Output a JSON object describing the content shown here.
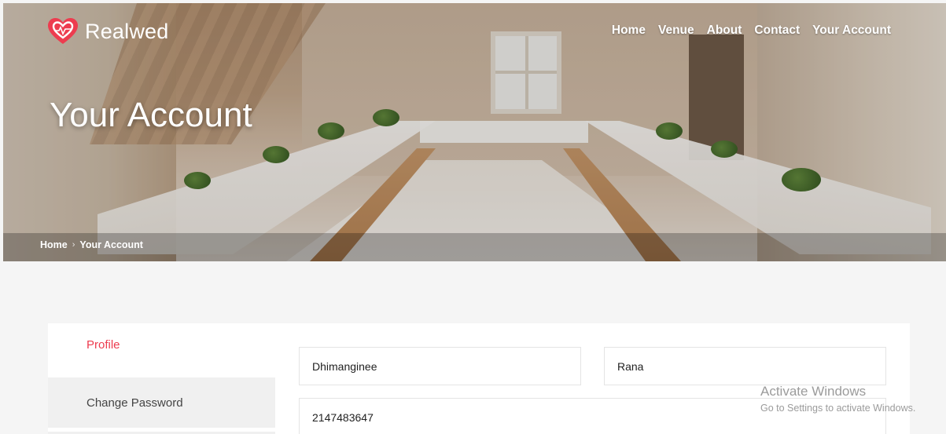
{
  "brand": {
    "name": "Realwed",
    "accent": "#ed3c4f"
  },
  "nav": {
    "items": [
      {
        "label": "Home"
      },
      {
        "label": "Venue"
      },
      {
        "label": "About"
      },
      {
        "label": "Contact"
      },
      {
        "label": "Your Account"
      }
    ]
  },
  "hero": {
    "title": "Your Account"
  },
  "breadcrumb": {
    "home": "Home",
    "separator": "›",
    "current": "Your Account"
  },
  "sidebar": {
    "tabs": [
      {
        "label": "Profile",
        "active": true
      },
      {
        "label": "Change Password",
        "active": false
      }
    ]
  },
  "form": {
    "first_name": "Dhimanginee",
    "last_name": "Rana",
    "phone": "2147483647"
  },
  "watermark": {
    "line1": "Activate Windows",
    "line2": "Go to Settings to activate Windows."
  }
}
